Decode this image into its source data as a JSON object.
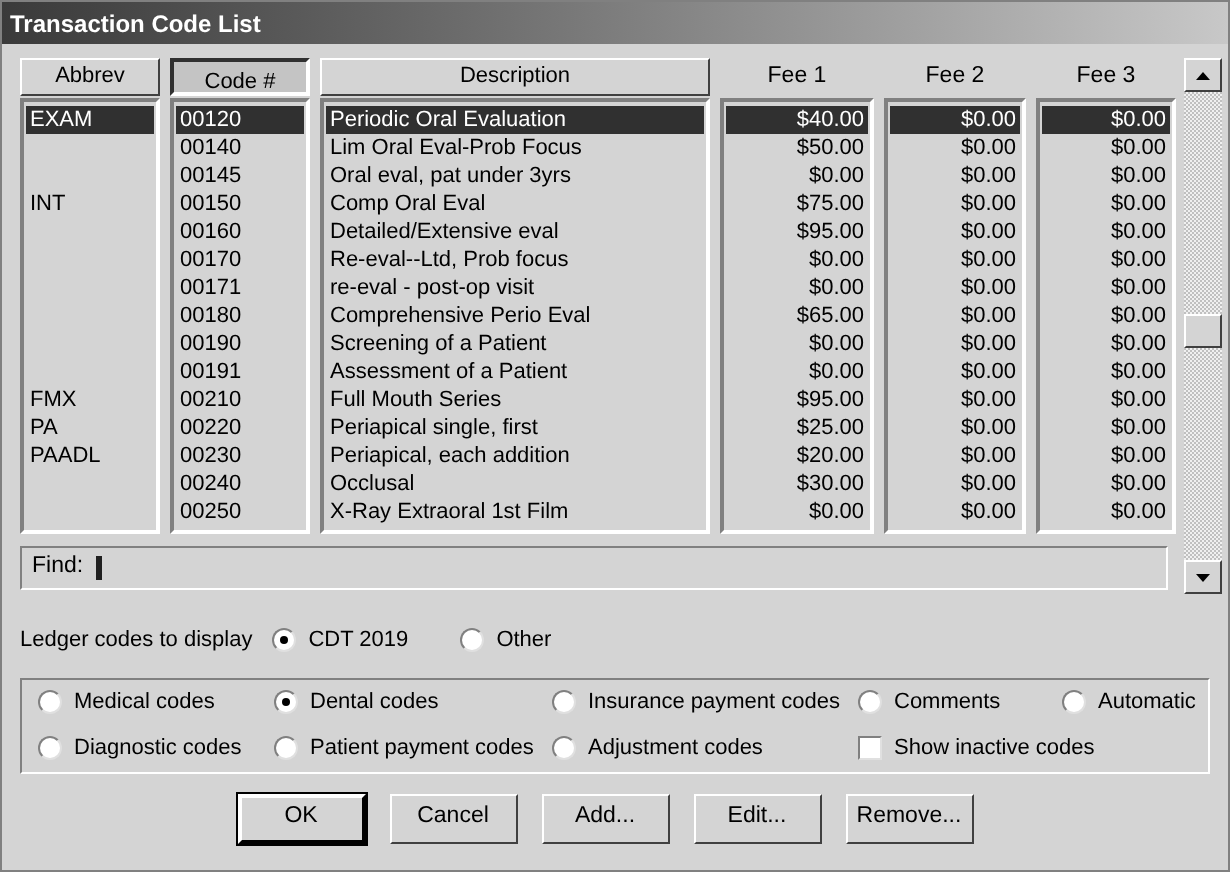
{
  "window": {
    "title": "Transaction Code List"
  },
  "columns": [
    {
      "label": "Abbrev",
      "kind": "button",
      "selected": false
    },
    {
      "label": "Code #",
      "kind": "button",
      "selected": true
    },
    {
      "label": "Description",
      "kind": "button",
      "selected": false
    },
    {
      "label": "Fee 1",
      "kind": "text"
    },
    {
      "label": "Fee 2",
      "kind": "text"
    },
    {
      "label": "Fee 3",
      "kind": "text"
    }
  ],
  "rows": [
    {
      "abbrev": "EXAM",
      "code": "00120",
      "description": "Periodic Oral Evaluation",
      "fee_1": "$40.00",
      "fee_2": "$0.00",
      "fee_3": "$0.00",
      "selected": true
    },
    {
      "abbrev": "",
      "code": "00140",
      "description": "Lim Oral Eval-Prob Focus",
      "fee_1": "$50.00",
      "fee_2": "$0.00",
      "fee_3": "$0.00",
      "selected": false
    },
    {
      "abbrev": "",
      "code": "00145",
      "description": "Oral eval, pat under 3yrs",
      "fee_1": "$0.00",
      "fee_2": "$0.00",
      "fee_3": "$0.00",
      "selected": false
    },
    {
      "abbrev": "INT",
      "code": "00150",
      "description": "Comp Oral Eval",
      "fee_1": "$75.00",
      "fee_2": "$0.00",
      "fee_3": "$0.00",
      "selected": false
    },
    {
      "abbrev": "",
      "code": "00160",
      "description": "Detailed/Extensive eval",
      "fee_1": "$95.00",
      "fee_2": "$0.00",
      "fee_3": "$0.00",
      "selected": false
    },
    {
      "abbrev": "",
      "code": "00170",
      "description": "Re-eval--Ltd, Prob focus",
      "fee_1": "$0.00",
      "fee_2": "$0.00",
      "fee_3": "$0.00",
      "selected": false
    },
    {
      "abbrev": "",
      "code": "00171",
      "description": "re-eval - post-op visit",
      "fee_1": "$0.00",
      "fee_2": "$0.00",
      "fee_3": "$0.00",
      "selected": false
    },
    {
      "abbrev": "",
      "code": "00180",
      "description": "Comprehensive Perio Eval",
      "fee_1": "$65.00",
      "fee_2": "$0.00",
      "fee_3": "$0.00",
      "selected": false
    },
    {
      "abbrev": "",
      "code": "00190",
      "description": "Screening of a Patient",
      "fee_1": "$0.00",
      "fee_2": "$0.00",
      "fee_3": "$0.00",
      "selected": false
    },
    {
      "abbrev": "",
      "code": "00191",
      "description": "Assessment of a Patient",
      "fee_1": "$0.00",
      "fee_2": "$0.00",
      "fee_3": "$0.00",
      "selected": false
    },
    {
      "abbrev": "FMX",
      "code": "00210",
      "description": "Full Mouth Series",
      "fee_1": "$95.00",
      "fee_2": "$0.00",
      "fee_3": "$0.00",
      "selected": false
    },
    {
      "abbrev": "PA",
      "code": "00220",
      "description": "Periapical single, first",
      "fee_1": "$25.00",
      "fee_2": "$0.00",
      "fee_3": "$0.00",
      "selected": false
    },
    {
      "abbrev": "PAADL",
      "code": "00230",
      "description": "Periapical, each addition",
      "fee_1": "$20.00",
      "fee_2": "$0.00",
      "fee_3": "$0.00",
      "selected": false
    },
    {
      "abbrev": "",
      "code": "00240",
      "description": "Occlusal",
      "fee_1": "$30.00",
      "fee_2": "$0.00",
      "fee_3": "$0.00",
      "selected": false
    },
    {
      "abbrev": "",
      "code": "00250",
      "description": "X-Ray Extraoral 1st Film",
      "fee_1": "$0.00",
      "fee_2": "$0.00",
      "fee_3": "$0.00",
      "selected": false
    }
  ],
  "find": {
    "label": "Find:"
  },
  "ledger": {
    "label": "Ledger codes to display",
    "options": [
      {
        "label": "CDT 2019",
        "selected": true
      },
      {
        "label": "Other",
        "selected": false
      }
    ]
  },
  "filters": [
    {
      "label": "Medical codes",
      "kind": "radio",
      "selected": false
    },
    {
      "label": "Dental codes",
      "kind": "radio",
      "selected": true
    },
    {
      "label": "Insurance payment codes",
      "kind": "radio",
      "selected": false
    },
    {
      "label": "Comments",
      "kind": "radio",
      "selected": false
    },
    {
      "label": "Automatic",
      "kind": "radio",
      "selected": false
    },
    {
      "label": "Diagnostic codes",
      "kind": "radio",
      "selected": false
    },
    {
      "label": "Patient payment codes",
      "kind": "radio",
      "selected": false
    },
    {
      "label": "Adjustment codes",
      "kind": "radio",
      "selected": false
    },
    {
      "label": "Show inactive codes",
      "kind": "checkbox",
      "checked": false
    }
  ],
  "buttons": [
    {
      "label": "OK",
      "default": true
    },
    {
      "label": "Cancel",
      "default": false
    },
    {
      "label": "Add...",
      "default": false
    },
    {
      "label": "Edit...",
      "default": false
    },
    {
      "label": "Remove...",
      "default": false
    }
  ]
}
